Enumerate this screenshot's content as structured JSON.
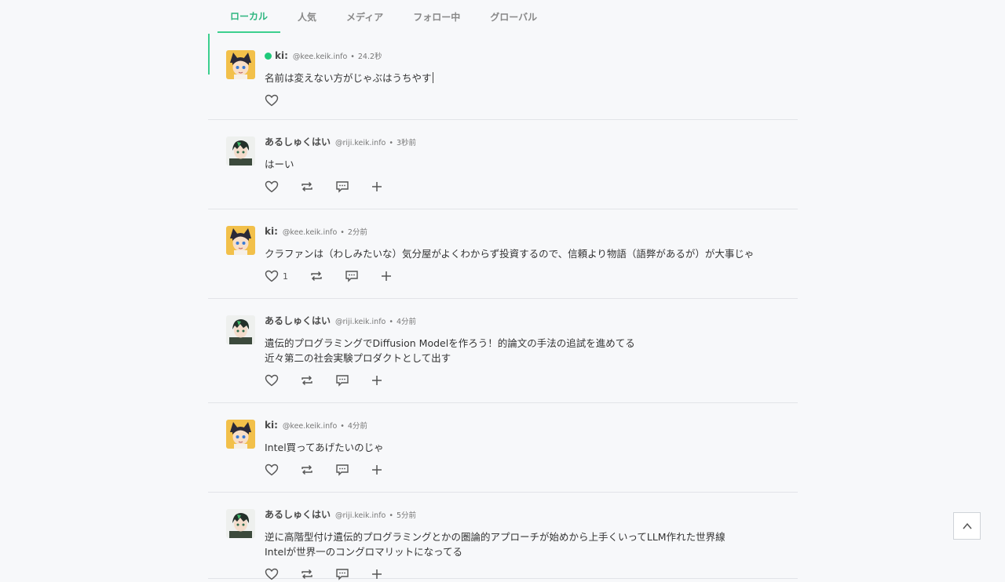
{
  "tabs": [
    {
      "label": "ローカル",
      "active": true
    },
    {
      "label": "人気",
      "active": false
    },
    {
      "label": "メディア",
      "active": false
    },
    {
      "label": "フォロー中",
      "active": false
    },
    {
      "label": "グローバル",
      "active": false
    }
  ],
  "posts": [
    {
      "name": "ki:",
      "handle": "@kee.keik.info",
      "time": "24.2秒",
      "online": true,
      "avatar": "cat-girl",
      "lines": [
        "名前は変えない方がじゃぶはうちやす"
      ],
      "composing": true,
      "likes": ""
    },
    {
      "name": "あるしゅくはい",
      "handle": "@riji.keik.info",
      "time": "3秒前",
      "avatar": "dark-boy",
      "lines": [
        "はーい"
      ],
      "likes": ""
    },
    {
      "name": "ki:",
      "handle": "@kee.keik.info",
      "time": "2分前",
      "avatar": "cat-girl",
      "lines": [
        "クラファンは（わしみたいな）気分屋がよくわからず投資するので、信頼より物語（語弊があるが）が大事じゃ"
      ],
      "likes": "1"
    },
    {
      "name": "あるしゅくはい",
      "handle": "@riji.keik.info",
      "time": "4分前",
      "avatar": "dark-boy",
      "lines": [
        "遺伝的プログラミングでDiffusion Modelを作ろう！的論文の手法の追試を進めてる",
        "近々第二の社会実験プロダクトとして出す"
      ],
      "likes": ""
    },
    {
      "name": "ki:",
      "handle": "@kee.keik.info",
      "time": "4分前",
      "avatar": "cat-girl",
      "lines": [
        "Intel買ってあげたいのじゃ"
      ],
      "likes": ""
    },
    {
      "name": "あるしゅくはい",
      "handle": "@riji.keik.info",
      "time": "5分前",
      "avatar": "dark-boy",
      "lines": [
        "逆に高階型付け遺伝的プログラミングとかの圏論的アプローチが始めから上手くいってLLM作れた世界線",
        "Intelが世界一のコングロマリットになってる"
      ],
      "likes": ""
    }
  ],
  "meta_separator": "•",
  "icons": {
    "like": "heart-icon",
    "renote": "repeat-icon",
    "reply": "speech-bubble-icon",
    "more": "plus-icon",
    "scroll_top": "chevron-up-icon"
  },
  "colors": {
    "accent": "#3ccf8e",
    "online": "#1ec97a",
    "background": "#f7f8fa"
  }
}
